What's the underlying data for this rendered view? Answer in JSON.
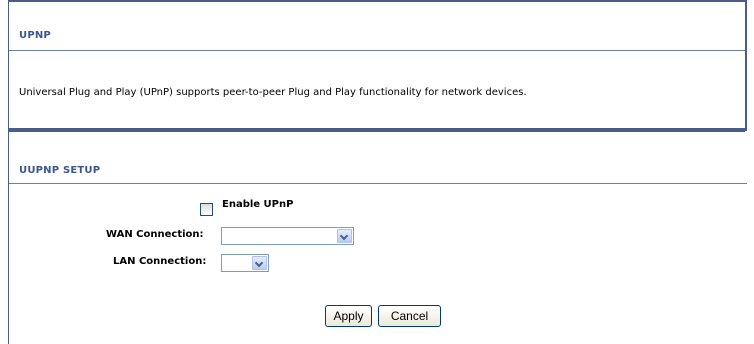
{
  "upnp_section": {
    "title": "UPNP",
    "description": "Universal Plug and Play (UPnP) supports peer-to-peer Plug and Play functionality for network devices."
  },
  "setup_section": {
    "title": "UUPNP SETUP",
    "enable_label": "Enable UPnP",
    "enable_checked": false,
    "wan_label": "WAN Connection:",
    "wan_value": "",
    "lan_label": "LAN Connection:",
    "lan_value": ""
  },
  "buttons": {
    "apply": "Apply",
    "cancel": "Cancel"
  },
  "colors": {
    "accent": "#3b5690",
    "border": "#4a5d8a"
  },
  "icons": {
    "dropdown": "chevron-down-icon"
  }
}
